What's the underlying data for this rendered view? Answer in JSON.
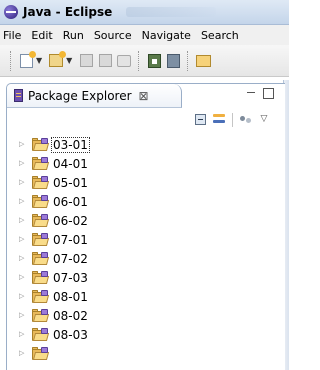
{
  "window": {
    "title": "Java - Eclipse"
  },
  "menubar": {
    "items": [
      "File",
      "Edit",
      "Run",
      "Source",
      "Navigate",
      "Search"
    ]
  },
  "package_explorer": {
    "tab_label": "Package Explorer",
    "close_symbol": "⊠",
    "tree_items": [
      {
        "label": "03-01",
        "selected": true
      },
      {
        "label": "04-01",
        "selected": false
      },
      {
        "label": "05-01",
        "selected": false
      },
      {
        "label": "06-01",
        "selected": false
      },
      {
        "label": "06-02",
        "selected": false
      },
      {
        "label": "07-01",
        "selected": false
      },
      {
        "label": "07-02",
        "selected": false
      },
      {
        "label": "07-03",
        "selected": false
      },
      {
        "label": "08-01",
        "selected": false
      },
      {
        "label": "08-02",
        "selected": false
      },
      {
        "label": "08-03",
        "selected": false
      }
    ]
  },
  "icons": {
    "expander": "▷",
    "view_menu": "▽",
    "dropdown": "▼"
  }
}
